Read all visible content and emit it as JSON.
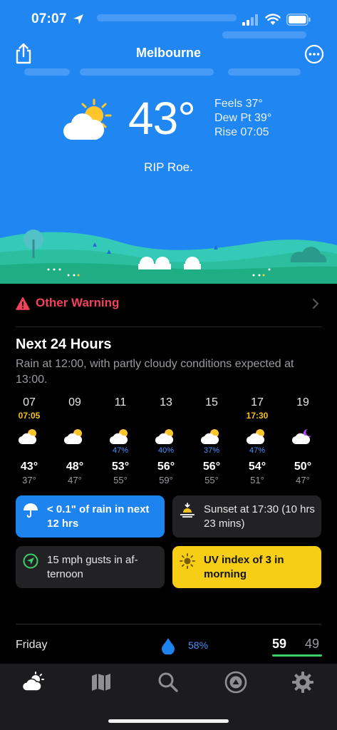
{
  "status_bar": {
    "time": "07:07"
  },
  "header": {
    "city": "Melbourne"
  },
  "current": {
    "temperature": "43°",
    "feels": "Feels 37°",
    "dew_point": "Dew Pt 39°",
    "rise": "Rise 07:05",
    "tagline": "RIP Roe."
  },
  "warning": {
    "label": "Other Warning"
  },
  "next24": {
    "title": "Next 24 Hours",
    "description": "Rain at 12:00, with partly cloudy conditions expected at 13:00.",
    "hours": [
      {
        "label": "07",
        "sub": "07:05",
        "precip": "",
        "high": "43°",
        "low": "37°",
        "icon": "partly-cloudy-day-icon"
      },
      {
        "label": "09",
        "sub": "",
        "precip": "",
        "high": "48°",
        "low": "47°",
        "icon": "partly-cloudy-day-icon"
      },
      {
        "label": "11",
        "sub": "",
        "precip": "47%",
        "high": "53°",
        "low": "55°",
        "icon": "partly-cloudy-day-icon"
      },
      {
        "label": "13",
        "sub": "",
        "precip": "40%",
        "high": "56°",
        "low": "59°",
        "icon": "partly-cloudy-day-icon"
      },
      {
        "label": "15",
        "sub": "",
        "precip": "37%",
        "high": "56°",
        "low": "55°",
        "icon": "partly-cloudy-day-icon"
      },
      {
        "label": "17",
        "sub": "17:30",
        "precip": "47%",
        "high": "54°",
        "low": "51°",
        "icon": "partly-cloudy-day-icon"
      },
      {
        "label": "19",
        "sub": "",
        "precip": "",
        "high": "50°",
        "low": "47°",
        "icon": "partly-cloudy-night-icon"
      }
    ]
  },
  "cards": {
    "rain": "< 0.1\" of rain in next 12 hrs",
    "sunset": "Sunset at 17:30 (10 hrs 23 mins)",
    "wind": "15 mph gusts in af-ternoon",
    "uv": "UV index of 3 in morning"
  },
  "daily": {
    "day": "Friday",
    "precip": "58%",
    "high": "59",
    "low": "49"
  },
  "tabs": [
    "forecast-tab",
    "map-tab",
    "search-tab",
    "radar-tab",
    "settings-tab"
  ],
  "colors": {
    "sky": "#1f86f2",
    "warning": "#f0425b",
    "rain_card": "#1d83ef",
    "uv_card": "#f7ce16",
    "precip": "#4a93ff"
  }
}
